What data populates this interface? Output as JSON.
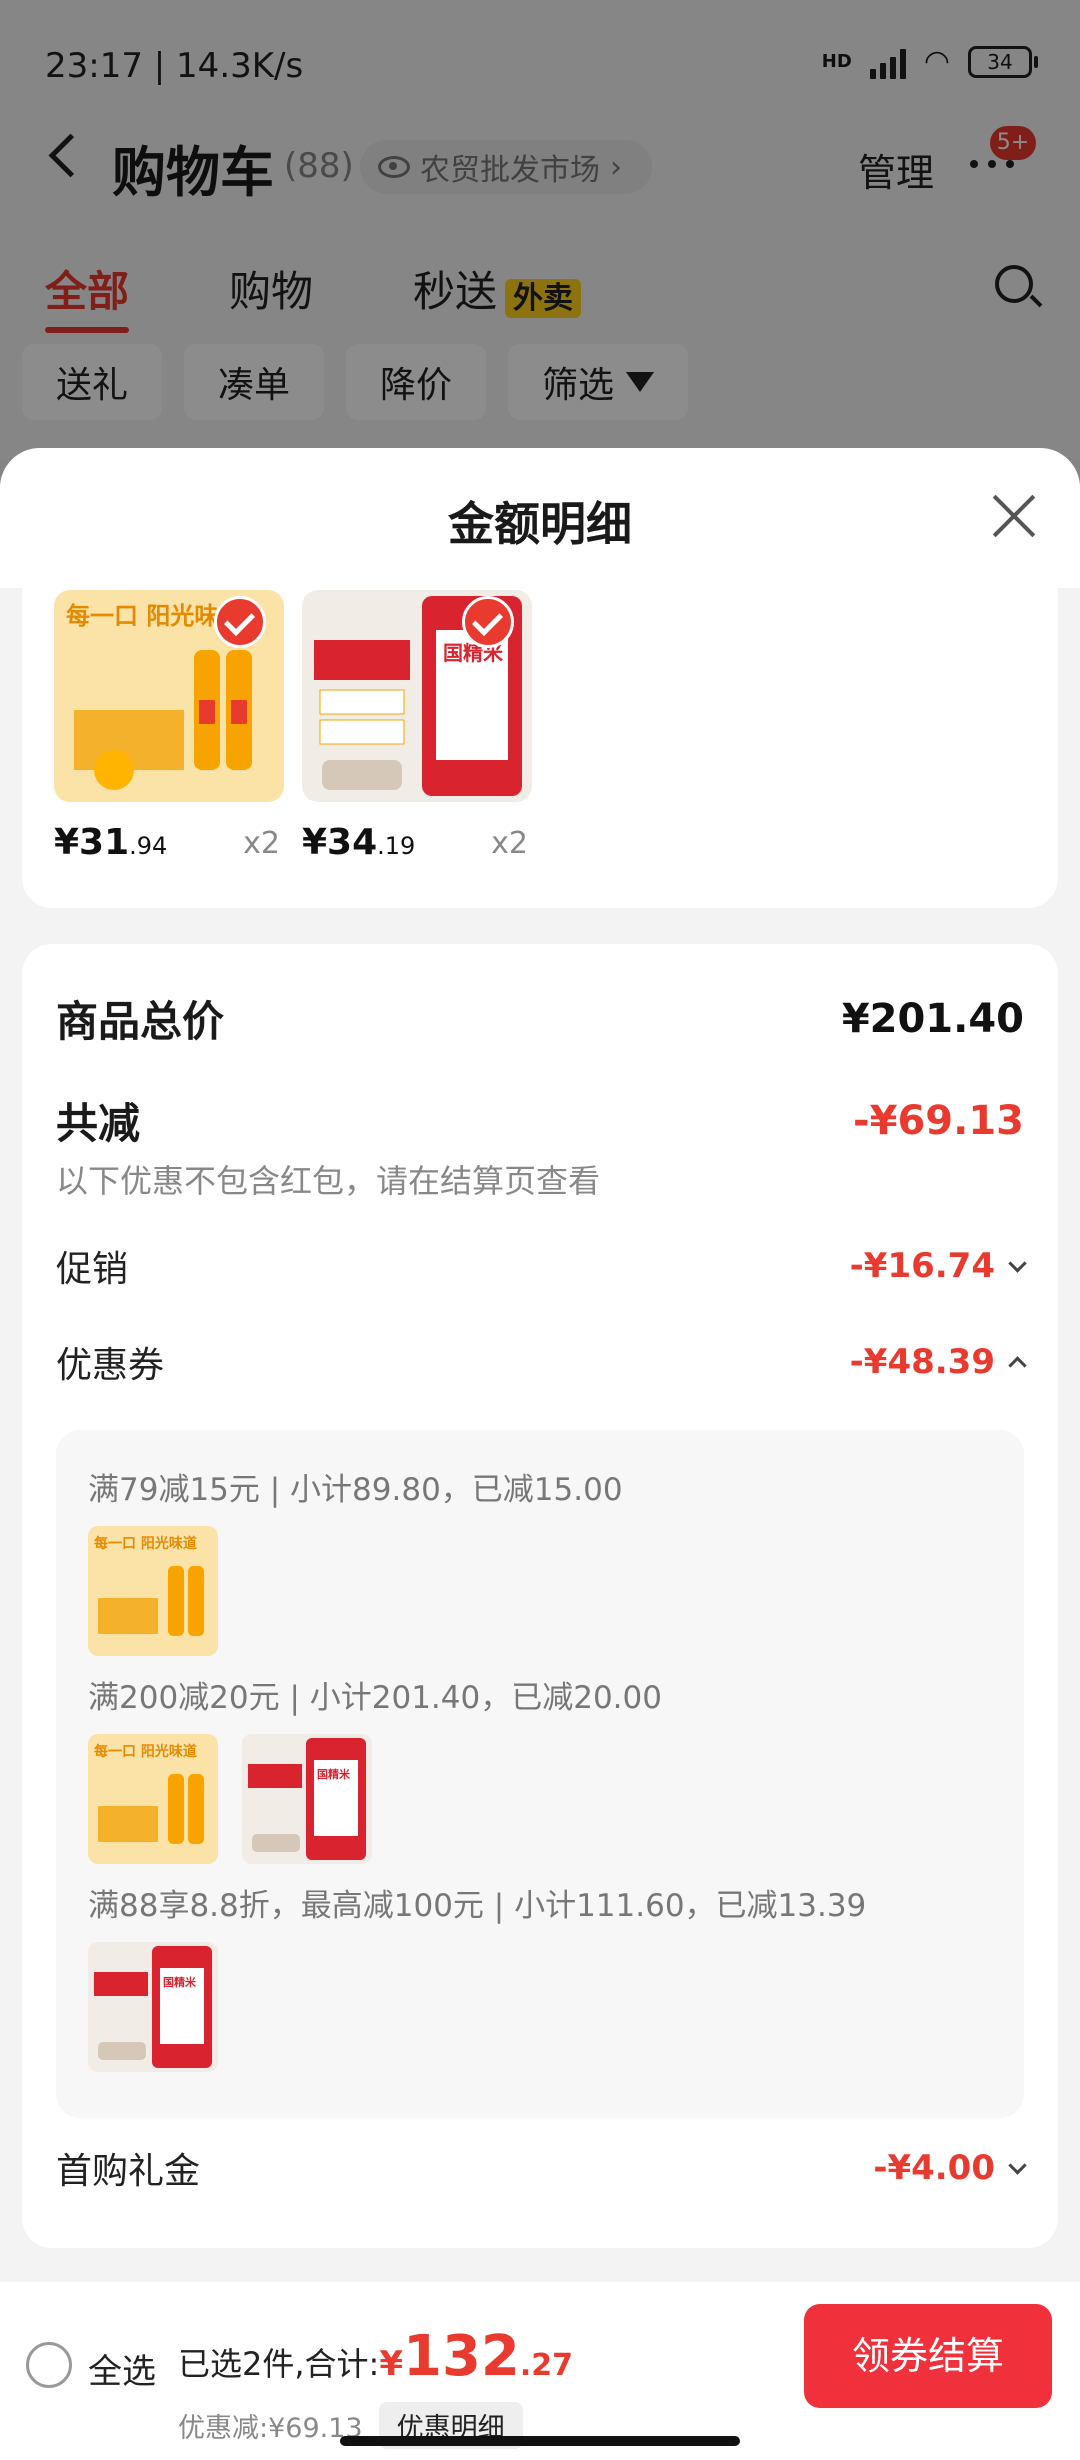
{
  "status_bar": {
    "time_speed": "23:17 | 14.3K/s",
    "network": "HD",
    "battery": "34"
  },
  "header": {
    "title": "购物车",
    "count": "(88)",
    "market_pill": "农贸批发市场",
    "manage": "管理",
    "badge": "5+"
  },
  "tabs": [
    {
      "label": "全部"
    },
    {
      "label": "购物"
    },
    {
      "label": "秒送",
      "tag": "外卖"
    }
  ],
  "filters": [
    "送礼",
    "凑单",
    "降价",
    "筛选"
  ],
  "sheet": {
    "title": "金额明细",
    "products": [
      {
        "price_int": "¥31",
        "price_dec": ".94",
        "qty": "x2",
        "image": "orange-juice-bottles",
        "image_caption": "每一口 阳光味道"
      },
      {
        "price_int": "¥34",
        "price_dec": ".19",
        "qty": "x2",
        "image": "rice-bag",
        "image_caption": "国精米"
      }
    ],
    "summary": {
      "total_label": "商品总价",
      "total_value": "¥201.40",
      "reduce_label": "共减",
      "reduce_value": "-¥69.13",
      "note": "以下优惠不包含红包，请在结算页查看",
      "promo_label": "促销",
      "promo_value": "-¥16.74",
      "coupon_label": "优惠券",
      "coupon_value": "-¥48.39",
      "gift_label": "首购礼金",
      "gift_value": "-¥4.00"
    },
    "coupons": [
      {
        "text": "满79减15元 | 小计89.80，已减15.00",
        "items": [
          "orange-juice-bottles"
        ]
      },
      {
        "text": "满200减20元 | 小计201.40，已减20.00",
        "items": [
          "orange-juice-bottles",
          "rice-bag"
        ]
      },
      {
        "text": "满88享8.8折，最高减100元 | 小计111.60，已减13.39",
        "items": [
          "rice-bag"
        ]
      }
    ]
  },
  "bottom_bar": {
    "select_all": "全选",
    "selected_prefix": "已选2件,合计:",
    "currency": "¥",
    "total_int": "132",
    "total_dec": ".27",
    "discount": "优惠减:¥69.13",
    "detail_button": "优惠明细",
    "checkout": "领券结算"
  },
  "colors": {
    "accent": "#e93a2f",
    "checkout": "#f0303a",
    "tag_yellow": "#ffd21e"
  }
}
